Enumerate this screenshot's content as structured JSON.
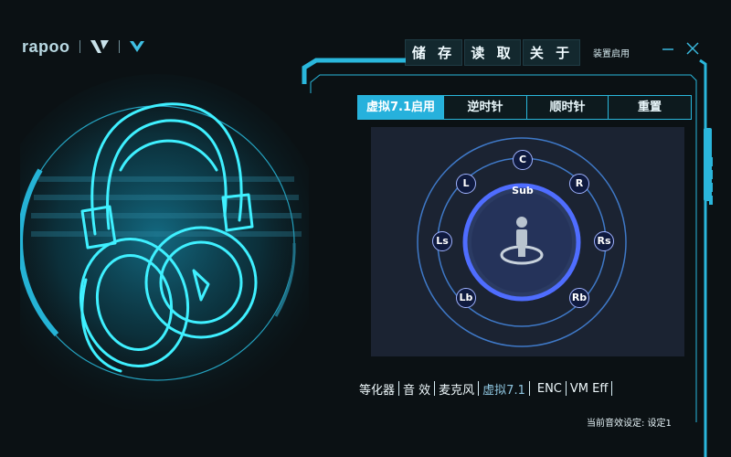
{
  "brand": {
    "name": "rapoo"
  },
  "toolbar": {
    "buttons": [
      "储 存",
      "读 取",
      "关 于"
    ],
    "status": "装置启用"
  },
  "tabs": [
    "虚拟7.1启用",
    "逆时针",
    "顺时针",
    "重置"
  ],
  "active_tab": "虚拟7.1启用",
  "speakers": {
    "C": "C",
    "L": "L",
    "R": "R",
    "Sub": "Sub",
    "Ls": "Ls",
    "Rs": "Rs",
    "Lb": "Lb",
    "Rb": "Rb"
  },
  "bottom_nav": [
    "等化器",
    "音  效",
    "麦克风",
    "虚拟7.1",
    "ENC",
    "VM Eff"
  ],
  "active_nav": "虚拟7.1",
  "preset_text": "当前音效设定: 设定1",
  "colors": {
    "accent": "#26b1dc",
    "speaker_ring": "#4f6dff",
    "background": "#0b1114"
  },
  "icons": [
    "rapoo-v-logo-icon",
    "minimize-icon",
    "close-icon",
    "user-icon",
    "headset-illustration"
  ]
}
